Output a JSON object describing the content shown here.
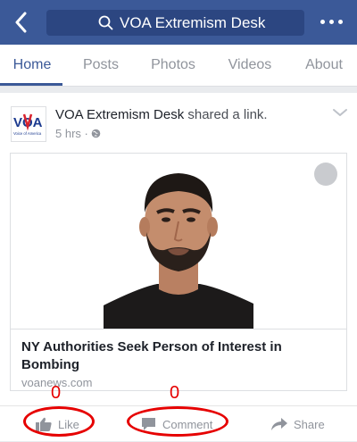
{
  "header": {
    "search_text": "VOA Extremism Desk"
  },
  "tabs": [
    {
      "label": "Home"
    },
    {
      "label": "Posts"
    },
    {
      "label": "Photos"
    },
    {
      "label": "Videos"
    },
    {
      "label": "About"
    }
  ],
  "post": {
    "author": "VOA Extremism Desk",
    "action_text": "shared a link.",
    "time": "5 hrs",
    "privacy_icon": "globe-icon",
    "avatar_text": "VOA",
    "avatar_subtext": "Voice of America",
    "link": {
      "headline": "NY Authorities Seek Person of Interest in Bombing",
      "domain": "voanews.com"
    }
  },
  "actions": {
    "like_label": "Like",
    "comment_label": "Comment",
    "share_label": "Share"
  },
  "annotations": {
    "like_count": "0",
    "comment_count": "0",
    "color": "#e60000"
  },
  "colors": {
    "brand": "#3b5998",
    "search_bg": "#2c4681",
    "muted": "#90949c"
  }
}
